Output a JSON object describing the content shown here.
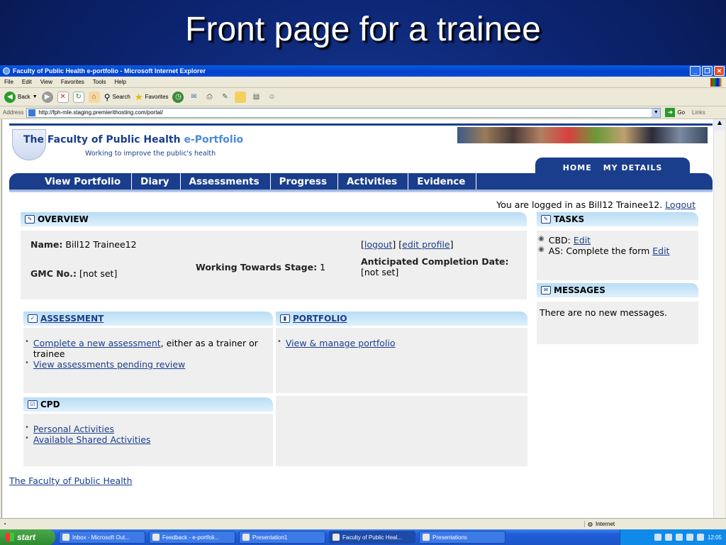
{
  "slide": {
    "title": "Front page for a trainee"
  },
  "browser": {
    "title": "Faculty of Public Health e-portfolio - Microsoft Internet Explorer",
    "menu": [
      "File",
      "Edit",
      "View",
      "Favorites",
      "Tools",
      "Help"
    ],
    "toolbar": {
      "back": "Back",
      "search": "Search",
      "favorites": "Favorites"
    },
    "address_label": "Address",
    "url": "http://fph-mle.staging.premierithosting.com/portal/",
    "go": "Go",
    "links": "Links",
    "status_zone": "Internet"
  },
  "site": {
    "brand_main": "The Faculty of Public Health ",
    "brand_accent": "e-Portfolio",
    "tagline": "Working to improve the public's health",
    "subnav": [
      "HOME",
      "MY DETAILS"
    ],
    "nav": [
      "View Portfolio",
      "Diary",
      "Assessments",
      "Progress",
      "Activities",
      "Evidence"
    ],
    "logged_text": "You are logged in as Bill12 Trainee12. ",
    "logout": "Logout",
    "footer_link": "The Faculty of Public Health"
  },
  "overview": {
    "title": "OVERVIEW",
    "name_label": "Name:",
    "name_value": "Bill12 Trainee12",
    "logout": "logout",
    "edit_profile": "edit profile",
    "gmc_label": "GMC No.:",
    "gmc_value": "[not set]",
    "stage_label": "Working Towards Stage:",
    "stage_value": "1",
    "completion_label": "Anticipated Completion Date:",
    "completion_value": "[not set]"
  },
  "assessment": {
    "title": "ASSESSMENT",
    "item1_link": "Complete a new assessment",
    "item1_rest": ", either as a trainer or trainee",
    "item2_link": "View assessments pending review"
  },
  "portfolio": {
    "title": "PORTFOLIO",
    "item1_link": "View & manage portfolio"
  },
  "cpd": {
    "title": "CPD",
    "items": [
      "Personal Activities",
      "Available Shared Activities"
    ]
  },
  "tasks": {
    "title": "TASKS",
    "cbd_label": "CBD: ",
    "cbd_link": "Edit",
    "as_label": "AS: Complete the form ",
    "as_link": "Edit"
  },
  "messages": {
    "title": "MESSAGES",
    "text": "There are no new messages."
  },
  "taskbar": {
    "start": "start",
    "tasks": [
      "Inbox - Microsoft Out...",
      "Feedback - e-portfoli...",
      "Presentation1",
      "Faculty of Public Heal...",
      "Presentations"
    ],
    "clock": "12:05"
  }
}
